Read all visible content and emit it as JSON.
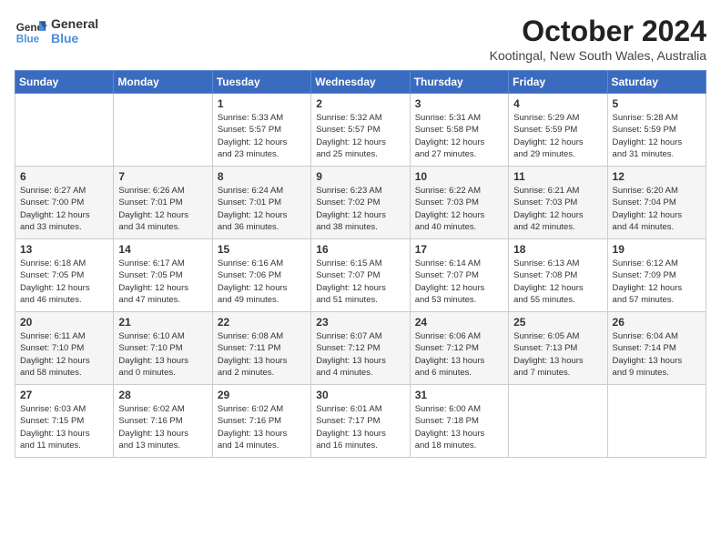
{
  "logo": {
    "line1": "General",
    "line2": "Blue"
  },
  "title": "October 2024",
  "location": "Kootingal, New South Wales, Australia",
  "days_of_week": [
    "Sunday",
    "Monday",
    "Tuesday",
    "Wednesday",
    "Thursday",
    "Friday",
    "Saturday"
  ],
  "weeks": [
    [
      {
        "day": "",
        "info": ""
      },
      {
        "day": "",
        "info": ""
      },
      {
        "day": "1",
        "info": "Sunrise: 5:33 AM\nSunset: 5:57 PM\nDaylight: 12 hours\nand 23 minutes."
      },
      {
        "day": "2",
        "info": "Sunrise: 5:32 AM\nSunset: 5:57 PM\nDaylight: 12 hours\nand 25 minutes."
      },
      {
        "day": "3",
        "info": "Sunrise: 5:31 AM\nSunset: 5:58 PM\nDaylight: 12 hours\nand 27 minutes."
      },
      {
        "day": "4",
        "info": "Sunrise: 5:29 AM\nSunset: 5:59 PM\nDaylight: 12 hours\nand 29 minutes."
      },
      {
        "day": "5",
        "info": "Sunrise: 5:28 AM\nSunset: 5:59 PM\nDaylight: 12 hours\nand 31 minutes."
      }
    ],
    [
      {
        "day": "6",
        "info": "Sunrise: 6:27 AM\nSunset: 7:00 PM\nDaylight: 12 hours\nand 33 minutes."
      },
      {
        "day": "7",
        "info": "Sunrise: 6:26 AM\nSunset: 7:01 PM\nDaylight: 12 hours\nand 34 minutes."
      },
      {
        "day": "8",
        "info": "Sunrise: 6:24 AM\nSunset: 7:01 PM\nDaylight: 12 hours\nand 36 minutes."
      },
      {
        "day": "9",
        "info": "Sunrise: 6:23 AM\nSunset: 7:02 PM\nDaylight: 12 hours\nand 38 minutes."
      },
      {
        "day": "10",
        "info": "Sunrise: 6:22 AM\nSunset: 7:03 PM\nDaylight: 12 hours\nand 40 minutes."
      },
      {
        "day": "11",
        "info": "Sunrise: 6:21 AM\nSunset: 7:03 PM\nDaylight: 12 hours\nand 42 minutes."
      },
      {
        "day": "12",
        "info": "Sunrise: 6:20 AM\nSunset: 7:04 PM\nDaylight: 12 hours\nand 44 minutes."
      }
    ],
    [
      {
        "day": "13",
        "info": "Sunrise: 6:18 AM\nSunset: 7:05 PM\nDaylight: 12 hours\nand 46 minutes."
      },
      {
        "day": "14",
        "info": "Sunrise: 6:17 AM\nSunset: 7:05 PM\nDaylight: 12 hours\nand 47 minutes."
      },
      {
        "day": "15",
        "info": "Sunrise: 6:16 AM\nSunset: 7:06 PM\nDaylight: 12 hours\nand 49 minutes."
      },
      {
        "day": "16",
        "info": "Sunrise: 6:15 AM\nSunset: 7:07 PM\nDaylight: 12 hours\nand 51 minutes."
      },
      {
        "day": "17",
        "info": "Sunrise: 6:14 AM\nSunset: 7:07 PM\nDaylight: 12 hours\nand 53 minutes."
      },
      {
        "day": "18",
        "info": "Sunrise: 6:13 AM\nSunset: 7:08 PM\nDaylight: 12 hours\nand 55 minutes."
      },
      {
        "day": "19",
        "info": "Sunrise: 6:12 AM\nSunset: 7:09 PM\nDaylight: 12 hours\nand 57 minutes."
      }
    ],
    [
      {
        "day": "20",
        "info": "Sunrise: 6:11 AM\nSunset: 7:10 PM\nDaylight: 12 hours\nand 58 minutes."
      },
      {
        "day": "21",
        "info": "Sunrise: 6:10 AM\nSunset: 7:10 PM\nDaylight: 13 hours\nand 0 minutes."
      },
      {
        "day": "22",
        "info": "Sunrise: 6:08 AM\nSunset: 7:11 PM\nDaylight: 13 hours\nand 2 minutes."
      },
      {
        "day": "23",
        "info": "Sunrise: 6:07 AM\nSunset: 7:12 PM\nDaylight: 13 hours\nand 4 minutes."
      },
      {
        "day": "24",
        "info": "Sunrise: 6:06 AM\nSunset: 7:12 PM\nDaylight: 13 hours\nand 6 minutes."
      },
      {
        "day": "25",
        "info": "Sunrise: 6:05 AM\nSunset: 7:13 PM\nDaylight: 13 hours\nand 7 minutes."
      },
      {
        "day": "26",
        "info": "Sunrise: 6:04 AM\nSunset: 7:14 PM\nDaylight: 13 hours\nand 9 minutes."
      }
    ],
    [
      {
        "day": "27",
        "info": "Sunrise: 6:03 AM\nSunset: 7:15 PM\nDaylight: 13 hours\nand 11 minutes."
      },
      {
        "day": "28",
        "info": "Sunrise: 6:02 AM\nSunset: 7:16 PM\nDaylight: 13 hours\nand 13 minutes."
      },
      {
        "day": "29",
        "info": "Sunrise: 6:02 AM\nSunset: 7:16 PM\nDaylight: 13 hours\nand 14 minutes."
      },
      {
        "day": "30",
        "info": "Sunrise: 6:01 AM\nSunset: 7:17 PM\nDaylight: 13 hours\nand 16 minutes."
      },
      {
        "day": "31",
        "info": "Sunrise: 6:00 AM\nSunset: 7:18 PM\nDaylight: 13 hours\nand 18 minutes."
      },
      {
        "day": "",
        "info": ""
      },
      {
        "day": "",
        "info": ""
      }
    ]
  ]
}
